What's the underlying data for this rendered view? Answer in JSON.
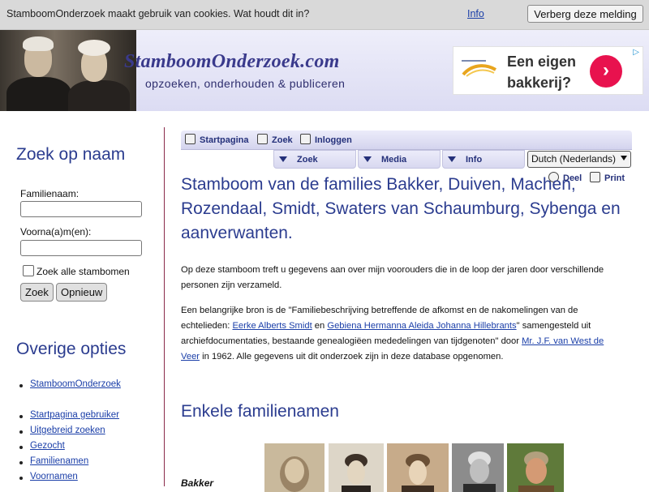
{
  "cookie": {
    "message": "StamboomOnderzoek maakt gebruik van cookies. Wat houdt dit in?",
    "info_link": "Info",
    "hide_button": "Verberg deze melding"
  },
  "header": {
    "site_title": "StamboomOnderzoek.com",
    "tagline": "opzoeken, onderhouden & publiceren",
    "ad": {
      "text_line1": "Een eigen",
      "text_line2": "bakkerij?",
      "go_glyph": "›",
      "adchoice": "▷"
    }
  },
  "sidebar": {
    "search_heading": "Zoek op naam",
    "surname_label": "Familienaam:",
    "surname_value": "",
    "firstname_label": "Voorna(a)m(en):",
    "firstname_value": "",
    "all_trees_label": "Zoek alle stambomen",
    "search_button": "Zoek",
    "reset_button": "Opnieuw",
    "options_heading": "Overige opties",
    "links_group1": [
      "StamboomOnderzoek"
    ],
    "links_group2": [
      "Startpagina gebruiker",
      "Uitgebreid zoeken",
      "Gezocht",
      "Familienamen",
      "Voornamen"
    ]
  },
  "nav": {
    "home": "Startpagina",
    "search": "Zoek",
    "login": "Inloggen",
    "tabs": [
      "Zoek",
      "Media",
      "Info"
    ],
    "language": "Dutch (Nederlands)",
    "share": "Deel",
    "print": "Print"
  },
  "main": {
    "title": "Stamboom van de families Bakker, Duiven, Machen, Rozendaal, Smidt, Swaters van Schaumburg, Sybenga en aanverwanten.",
    "intro": "Op deze stamboom treft u gegevens aan over mijn voorouders die in de loop der jaren door verschillende personen zijn verzameld.",
    "source_part1": "Een belangrijke bron is de \"Familiebeschrijving betreffende de afkomst en de nakomelingen van de echtelieden: ",
    "source_link1": "Eerke Alberts Smidt",
    "source_part2": " en ",
    "source_link2": "Gebiena Hermanna Aleida Johanna Hillebrants",
    "source_part3": "\" samengesteld uit archiefdocumentaties, bestaande genealogiëen mededelingen van tijdgenoten\" door ",
    "source_link3": "Mr. J.F. van West de Veer",
    "source_part4": " in 1962. Alle gegevens uit dit onderzoek zijn in deze database opgenomen.",
    "families_heading": "Enkele familienamen",
    "first_family": "Bakker"
  },
  "colors": {
    "heading": "#2b3c8f",
    "link": "#1a3ea8",
    "sidebar_border": "#8a2a4a",
    "ad_button": "#e8124e"
  }
}
